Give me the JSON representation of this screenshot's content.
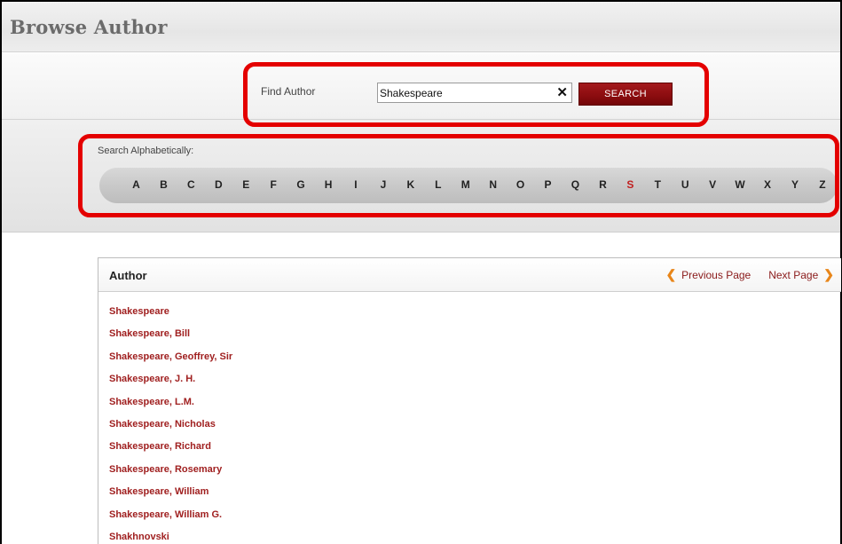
{
  "page": {
    "title": "Browse Author"
  },
  "find": {
    "label": "Find Author",
    "value": "Shakespeare",
    "clear_icon": "✕",
    "button_label": "SEARCH"
  },
  "alpha": {
    "label": "Search Alphabetically:",
    "letters": [
      "A",
      "B",
      "C",
      "D",
      "E",
      "F",
      "G",
      "H",
      "I",
      "J",
      "K",
      "L",
      "M",
      "N",
      "O",
      "P",
      "Q",
      "R",
      "S",
      "T",
      "U",
      "V",
      "W",
      "X",
      "Y",
      "Z"
    ],
    "active_letter": "S",
    "active_color": "#c02020"
  },
  "results": {
    "header": "Author",
    "prev_label": "Previous Page",
    "next_label": "Next Page",
    "prev_icon": "chevron-left-icon",
    "next_icon": "chevron-right-icon",
    "items": [
      "Shakespeare",
      "Shakespeare, Bill",
      "Shakespeare, Geoffrey, Sir",
      "Shakespeare, J. H.",
      "Shakespeare, L.M.",
      "Shakespeare, Nicholas",
      "Shakespeare, Richard",
      "Shakespeare, Rosemary",
      "Shakespeare, William",
      "Shakespeare, William G.",
      "Shakhnovski"
    ]
  },
  "colors": {
    "highlight_outline": "#e40000",
    "search_button": "#8a0c0f",
    "link": "#a02020",
    "pager_arrow": "#e8861a"
  }
}
